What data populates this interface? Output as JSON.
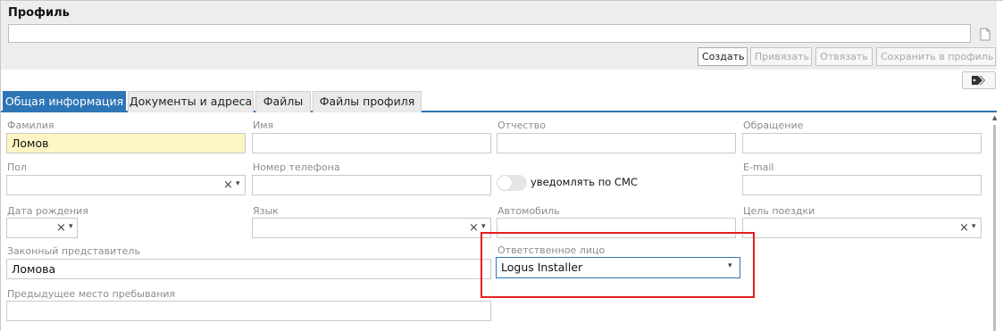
{
  "profile": {
    "title": "Профиль",
    "input_value": ""
  },
  "toolbar": {
    "create": "Создать",
    "bind": "Привязать",
    "unbind": "Отвязать",
    "save_to_profile": "Сохранить в профиль"
  },
  "tabs": [
    {
      "label": "Общая информация"
    },
    {
      "label": "Документы и адреса"
    },
    {
      "label": "Файлы"
    },
    {
      "label": "Файлы профиля"
    }
  ],
  "form": {
    "surname": {
      "label": "Фамилия",
      "value": "Ломов"
    },
    "name": {
      "label": "Имя",
      "value": ""
    },
    "patronymic": {
      "label": "Отчество",
      "value": ""
    },
    "salutation": {
      "label": "Обращение",
      "value": ""
    },
    "gender": {
      "label": "Пол",
      "value": ""
    },
    "phone": {
      "label": "Номер телефона",
      "value": ""
    },
    "sms_toggle": {
      "label": "уведомлять по СМС",
      "on": false
    },
    "email": {
      "label": "E-mail",
      "value": ""
    },
    "birth_date": {
      "label": "Дата рождения",
      "value": ""
    },
    "language": {
      "label": "Язык",
      "value": ""
    },
    "car": {
      "label": "Автомобиль",
      "value": ""
    },
    "trip_purpose": {
      "label": "Цель поездки",
      "value": ""
    },
    "legal_rep": {
      "label": "Законный представитель",
      "value": "Ломова"
    },
    "responsible": {
      "label": "Ответственное лицо",
      "value": "Logus Installer"
    },
    "prev_place": {
      "label": "Предыдущее место пребывания",
      "value": ""
    }
  },
  "glyphs": {
    "clear": "×",
    "caret": "▾",
    "scroll_up": "▲"
  },
  "colors": {
    "accent": "#2e75b6",
    "highlight": "#e41e1e",
    "required_field": "#fdf6c4"
  }
}
